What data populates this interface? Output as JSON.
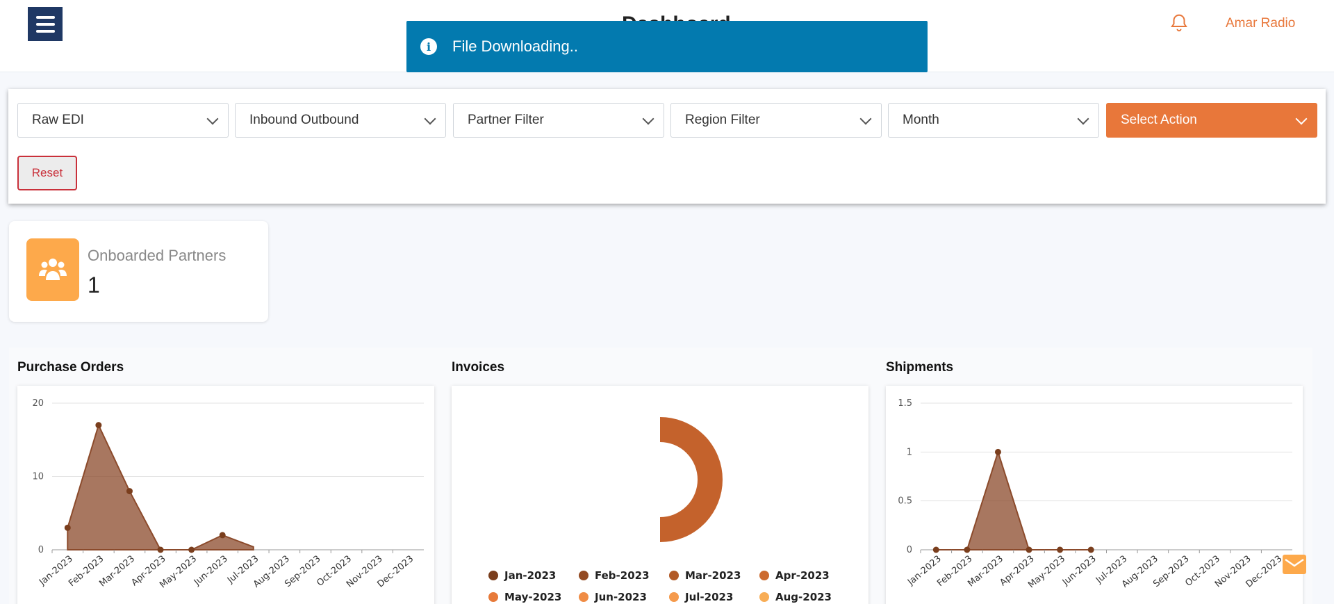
{
  "header": {
    "page_title": "Dashboard",
    "user_name": "Amar Radio",
    "icons": {
      "menu": "hamburger-icon",
      "notifications": "bell-icon"
    }
  },
  "toast": {
    "message": "File Downloading..",
    "icon": "info-icon",
    "color": "#037aaf"
  },
  "filters": {
    "raw_edi": "Raw EDI",
    "direction": "Inbound Outbound",
    "partner": "Partner Filter",
    "region": "Region Filter",
    "period": "Month",
    "action": "Select Action",
    "reset": "Reset"
  },
  "kpi": {
    "label": "Onboarded Partners",
    "value": "1",
    "icon": "users-icon"
  },
  "charts": {
    "purchase_orders_title": "Purchase Orders",
    "invoices_title": "Invoices",
    "shipments_title": "Shipments"
  },
  "colors": {
    "accent": "#e8773a",
    "navy": "#1f3864",
    "area": "#8b4a2b"
  },
  "chart_data": [
    {
      "type": "area",
      "title": "Purchase Orders",
      "categories": [
        "Jan-2023",
        "Feb-2023",
        "Mar-2023",
        "Apr-2023",
        "May-2023",
        "Jun-2023",
        "Jul-2023",
        "Aug-2023",
        "Sep-2023",
        "Oct-2023",
        "Nov-2023",
        "Dec-2023"
      ],
      "series": [
        {
          "values": [
            3,
            17,
            8,
            0,
            0,
            2,
            0.4
          ]
        }
      ],
      "ylim": [
        0,
        20
      ],
      "yticks": [
        0,
        10,
        20
      ],
      "grid": true
    },
    {
      "type": "pie",
      "title": "Invoices",
      "style": "donut",
      "slices": [
        {
          "label": "Jan-2023",
          "value": 0
        },
        {
          "label": "Feb-2023",
          "value": 0
        },
        {
          "label": "Mar-2023",
          "value": 1
        },
        {
          "label": "Apr-2023",
          "value": 0
        },
        {
          "label": "May-2023",
          "value": 0
        },
        {
          "label": "Jun-2023",
          "value": 0
        },
        {
          "label": "Jul-2023",
          "value": 0
        },
        {
          "label": "Aug-2023",
          "value": 0
        }
      ],
      "legend_colors": [
        "#7a3e1d",
        "#934a22",
        "#b25a27",
        "#cc6a2f",
        "#e77a3a",
        "#f08c45",
        "#f59a4c",
        "#f8ad56"
      ],
      "legend_position": "bottom"
    },
    {
      "type": "area",
      "title": "Shipments",
      "categories": [
        "Jan-2023",
        "Feb-2023",
        "Mar-2023",
        "Apr-2023",
        "May-2023",
        "Jun-2023",
        "Jul-2023",
        "Aug-2023",
        "Sep-2023",
        "Oct-2023",
        "Nov-2023",
        "Dec-2023"
      ],
      "series": [
        {
          "values": [
            0,
            0,
            1,
            0,
            0,
            0
          ]
        }
      ],
      "ylim": [
        0,
        1.5
      ],
      "yticks": [
        0,
        0.5,
        1,
        1.5
      ],
      "grid": true
    }
  ]
}
